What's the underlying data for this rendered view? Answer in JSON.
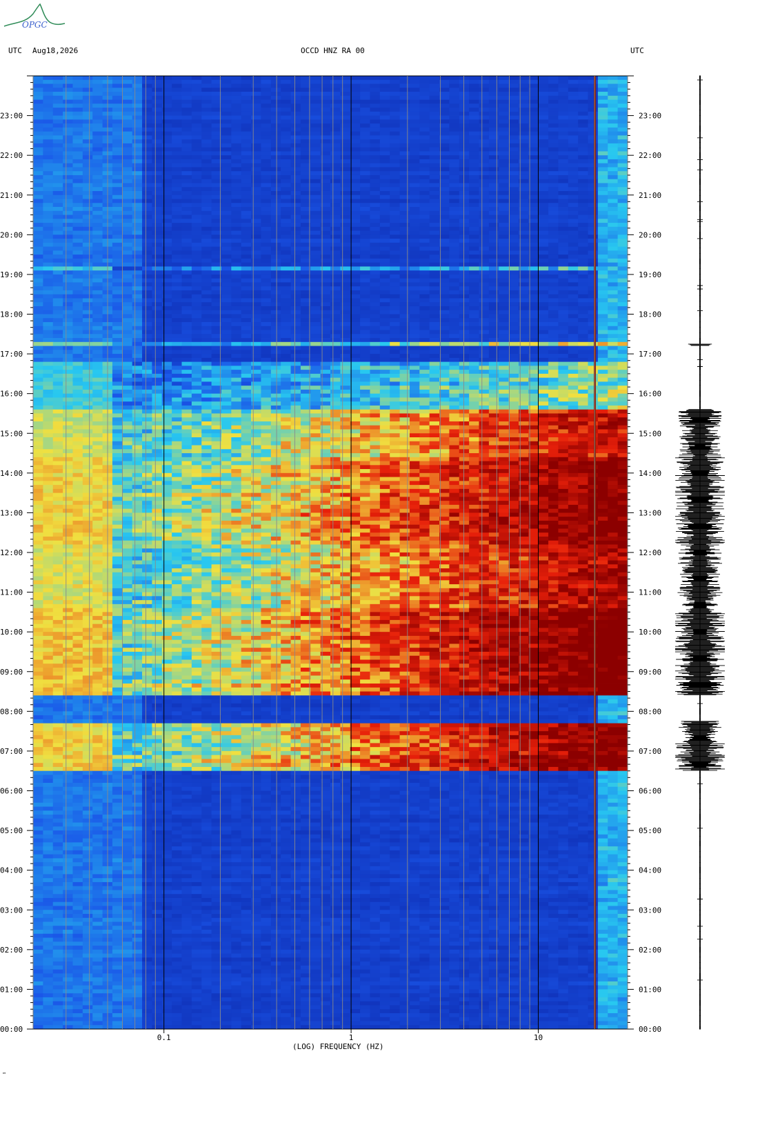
{
  "header": {
    "logo_text": "OPGC",
    "left_utc": "UTC",
    "date": "Aug18,2026",
    "station": "OCCD HNZ RA 00",
    "right_utc": "UTC"
  },
  "footer_mark": "™",
  "chart_data": {
    "type": "heatmap",
    "title": "OCCD HNZ RA 00",
    "date": "Aug18,2026",
    "xlabel": "(LOG) FREQUENCY (HZ)",
    "ylabel": "UTC",
    "x_scale": "log",
    "xlim": [
      0.02,
      30
    ],
    "ylim_hours": [
      0,
      24
    ],
    "x_ticks": [
      "0.1",
      "1",
      "10"
    ],
    "y_ticks": [
      "00:00",
      "01:00",
      "02:00",
      "03:00",
      "04:00",
      "05:00",
      "06:00",
      "07:00",
      "08:00",
      "09:00",
      "10:00",
      "11:00",
      "12:00",
      "13:00",
      "14:00",
      "15:00",
      "16:00",
      "17:00",
      "18:00",
      "19:00",
      "20:00",
      "21:00",
      "22:00",
      "23:00"
    ],
    "colormap": [
      "#0a1fa0",
      "#1a55e8",
      "#28c8f0",
      "#f0e040",
      "#e8200a",
      "#8c0000"
    ],
    "activity_bursts_utc_hours": [
      {
        "start": 6.5,
        "end": 7.75,
        "level": 0.9
      },
      {
        "start": 8.4,
        "end": 10.6,
        "level": 0.95
      },
      {
        "start": 10.6,
        "end": 12.2,
        "level": 0.8
      },
      {
        "start": 12.2,
        "end": 14.4,
        "level": 0.9
      },
      {
        "start": 14.4,
        "end": 15.6,
        "level": 0.75
      },
      {
        "start": 15.6,
        "end": 16.8,
        "level": 0.35
      },
      {
        "start": 17.2,
        "end": 17.25,
        "level": 0.5
      },
      {
        "start": 19.1,
        "end": 19.2,
        "level": 0.3
      }
    ],
    "waveform_panel": true
  }
}
